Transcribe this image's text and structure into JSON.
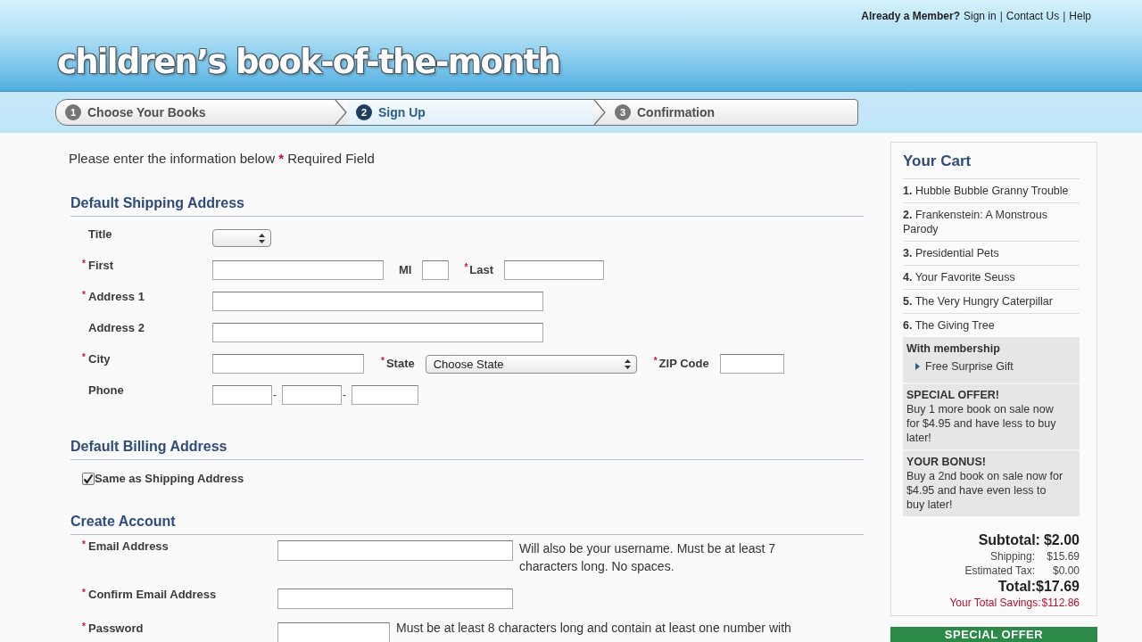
{
  "header": {
    "logo": "children’s book-of-the-month",
    "account_links": [
      {
        "kind": "prompt",
        "text": "Already a Member?"
      },
      {
        "kind": "link",
        "text": "Sign in"
      },
      {
        "kind": "separator",
        "text": "|"
      },
      {
        "kind": "link",
        "text": "Contact Us"
      },
      {
        "kind": "separator",
        "text": "|"
      },
      {
        "kind": "link",
        "text": "Help"
      }
    ]
  },
  "steps": [
    {
      "number": "1",
      "label": "Choose Your Books",
      "selected": false
    },
    {
      "number": "2",
      "label": "Sign Up",
      "selected": true
    },
    {
      "number": "3",
      "label": "Confirmation",
      "selected": false
    }
  ],
  "intro": {
    "text": "Please enter the information below",
    "mark": "*",
    "note": "Required Field"
  },
  "shipping": {
    "heading": "Default Shipping Address",
    "title": {
      "label": "Title"
    },
    "first": {
      "label": "First",
      "mark": "*"
    },
    "middle_initial": {
      "label": "MI"
    },
    "last": {
      "label": "Last",
      "mark": "*"
    },
    "address_1": {
      "label": "Address 1",
      "mark": "*"
    },
    "address_2": {
      "label": "Address 2"
    },
    "city": {
      "label": "City",
      "mark": "*"
    },
    "state": {
      "label": "State",
      "mark": "*",
      "value": "Choose State"
    },
    "zip": {
      "label": "ZIP Code",
      "mark": "*"
    },
    "phone": {
      "label": "Phone",
      "separators": [
        "-",
        "-"
      ]
    }
  },
  "billing": {
    "heading": "Default Billing Address",
    "same_as_shipping": {
      "label": "Same as Shipping Address",
      "checked": true
    }
  },
  "account": {
    "heading": "Create Account",
    "fields": [
      {
        "kind": "email",
        "label": "Email Address",
        "mark": "*",
        "hint": "Will also be your username. Must be at least 7 characters long. No spaces."
      },
      {
        "kind": "email",
        "label": "Confirm Email Address",
        "mark": "*"
      },
      {
        "kind": "password",
        "label": "Password",
        "mark": "*",
        "hint": "Must be at least 8 characters long and contain at least one number with"
      }
    ]
  },
  "cart": {
    "title": "Your Cart",
    "items": [
      "**1.** Hubble Bubble Granny Trouble",
      "**2.** Frankenstein: A Monstrous Parody",
      "**3.** Presidential Pets",
      "**4.** Your Favorite Seuss",
      "**5.** The Very Hungry Caterpillar",
      "**6.** The Giving Tree"
    ],
    "membership": {
      "title": "With membership",
      "perk": "Free Surprise Gift"
    },
    "offers": [
      {
        "title": "SPECIAL OFFER!",
        "text": "Buy 1 more book on sale now for $4.95 and have less to buy later!"
      },
      {
        "title": "YOUR BONUS!",
        "text": "Buy a 2nd book on sale now for $4.95 and have even less to buy later!"
      }
    ],
    "totals": [
      {
        "kind": "major",
        "label": "Subtotal:",
        "value": "$2.00"
      },
      {
        "kind": "minor",
        "label": "Shipping:",
        "value": "$15.69"
      },
      {
        "kind": "minor",
        "label": "Estimated Tax:",
        "value": "$0.00"
      },
      {
        "kind": "grand",
        "label": "Total:",
        "value": "$17.69"
      },
      {
        "kind": "savings",
        "label": "Your Total Savings:",
        "value": "$112.86"
      }
    ],
    "button": "SPECIAL OFFER"
  }
}
